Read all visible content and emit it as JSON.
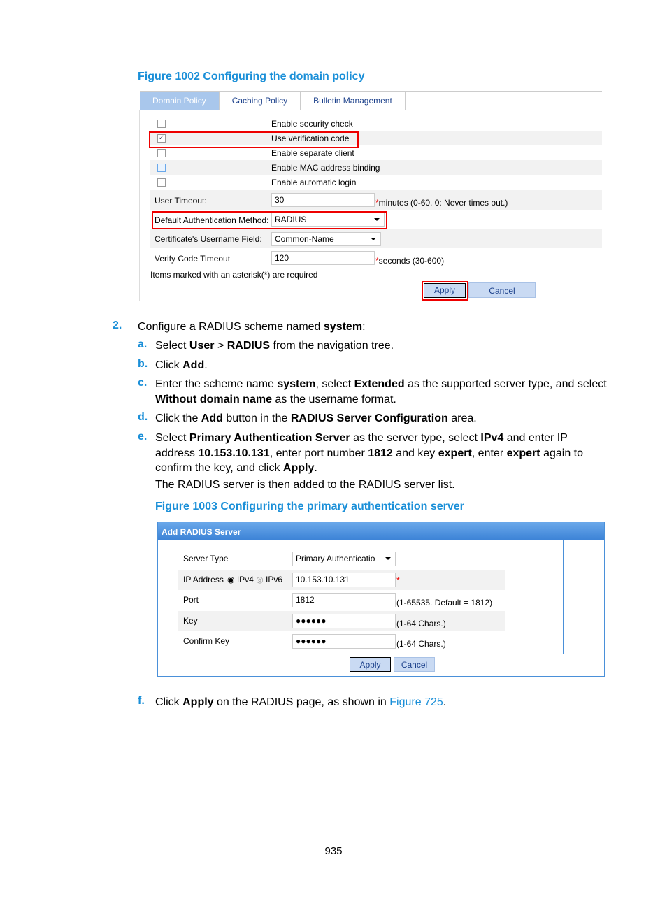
{
  "figure1": {
    "title": "Figure 1002 Configuring the domain policy",
    "tabs": [
      "Domain Policy",
      "Caching Policy",
      "Bulletin Management"
    ],
    "checkboxes": [
      {
        "label": "Enable security check",
        "checked": false
      },
      {
        "label": "Use verification code",
        "checked": true
      },
      {
        "label": "Enable separate client",
        "checked": false
      },
      {
        "label": "Enable MAC address binding",
        "checked": false
      },
      {
        "label": "Enable automatic login",
        "checked": false
      }
    ],
    "user_timeout_label": "User Timeout:",
    "user_timeout_value": "30",
    "user_timeout_hint": "minutes (0-60. 0: Never times out.)",
    "auth_method_label": "Default Authentication Method:",
    "auth_method_value": "RADIUS",
    "cert_label": "Certificate's Username Field:",
    "cert_value": "Common-Name",
    "verify_label": "Verify Code Timeout",
    "verify_value": "120",
    "verify_hint": "seconds (30-600)",
    "required_note": "Items marked with an asterisk(*) are required",
    "apply": "Apply",
    "cancel": "Cancel",
    "asterisk": "*"
  },
  "steps": {
    "s2_num": "2.",
    "s2": [
      "Configure a RADIUS scheme named ",
      "system",
      ":"
    ],
    "a_num": "a.",
    "a": [
      "Select ",
      "User",
      " > ",
      "RADIUS",
      " from the navigation tree."
    ],
    "b_num": "b.",
    "b": [
      "Click ",
      "Add",
      "."
    ],
    "c_num": "c.",
    "c": [
      "Enter the scheme name ",
      "system",
      ", select ",
      "Extended",
      " as the supported server type, and select ",
      "Without domain name",
      " as the username format."
    ],
    "d_num": "d.",
    "d": [
      "Click the ",
      "Add",
      " button in the ",
      "RADIUS Server Configuration",
      " area."
    ],
    "e_num": "e.",
    "e": [
      "Select ",
      "Primary Authentication Server",
      " as the server type, select ",
      "IPv4",
      " and enter IP address ",
      "10.153.10.131",
      ", enter port number ",
      "1812",
      " and key ",
      "expert",
      ", enter ",
      "expert",
      " again to confirm the key, and click ",
      "Apply",
      "."
    ],
    "e_note": "The RADIUS server is then added to the RADIUS server list.",
    "f_num": "f.",
    "f": [
      "Click ",
      "Apply",
      " on the RADIUS page, as shown in ",
      "Figure 725",
      "."
    ]
  },
  "figure2": {
    "title": "Figure 1003 Configuring the primary authentication server",
    "header": "Add RADIUS Server",
    "server_type_label": "Server Type",
    "server_type_value": "Primary Authenticatio",
    "ip_label": "IP Address",
    "ipv4": "IPv4",
    "ipv6": "IPv6",
    "ip_selected": "IPv4",
    "ip_value": "10.153.10.131",
    "port_label": "Port",
    "port_value": "1812",
    "port_hint": "(1-65535. Default = 1812)",
    "key_label": "Key",
    "key_value": "●●●●●●",
    "key_hint": "(1-64 Chars.)",
    "confirm_label": "Confirm Key",
    "confirm_value": "●●●●●●",
    "confirm_hint": "(1-64 Chars.)",
    "apply": "Apply",
    "cancel": "Cancel",
    "asterisk": "*"
  },
  "page_number": "935",
  "colors": {
    "accent": "#1a8fd8",
    "highlight": "#e00000",
    "header_blue": "#4a90d9"
  }
}
